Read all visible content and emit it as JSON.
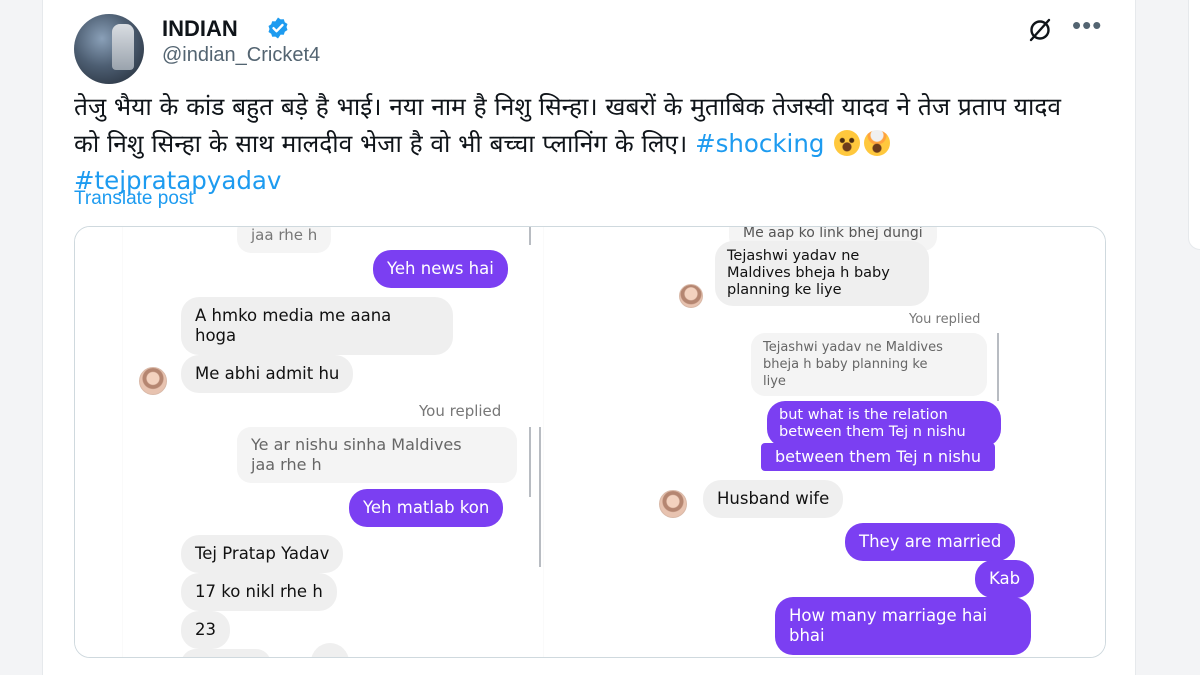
{
  "post": {
    "display_name": "INDIAN",
    "handle": "@indian_Cricket4",
    "text_main": "तेजु भैया के कांड बहुत बड़े है भाई। नया नाम है निशु सिन्हा। खबरों के मुताबिक तेजस्वी यादव ने तेज प्रताप यादव को निशु सिन्हा के साथ मालदीव भेजा है वो भी बच्चा प्लानिंग के लिए।",
    "hashtag_1": "#shocking",
    "hashtag_2": "#tejpratapyadav",
    "translate_label": "Translate post",
    "icons": [
      "verified-badge-icon",
      "grok-icon",
      "more-icon",
      "emoji-hushed-face",
      "emoji-exploding-head"
    ],
    "colors": {
      "link": "#1d9bf0",
      "verified": "#1d9bf0",
      "sent_bubble": "#7b3ff2"
    }
  },
  "chat_left": {
    "top_fragment": "jaa rhe h",
    "msg_1": "Yeh news hai",
    "msg_2_line1": "A hmko media me aana",
    "msg_2_line2": "hoga",
    "msg_3": "Me abhi admit hu",
    "you_replied": "You replied",
    "quote_line1": "Ye ar nishu sinha Maldives",
    "quote_line2": "jaa rhe h",
    "msg_4": "Yeh matlab kon",
    "msg_5": "Tej Pratap Yadav",
    "msg_6": "17 ko nikl rhe h",
    "msg_7": "23"
  },
  "chat_right": {
    "top_fragment": "Me aap ko link bhej dungi",
    "msg_1_line1": "Tejashwi yadav ne",
    "msg_1_line2": "Maldives bheja h baby",
    "msg_1_line3": "planning ke liye",
    "you_replied": "You replied",
    "quote_line1": "Tejashwi yadav ne Maldives",
    "quote_line2": "bheja h baby planning ke",
    "quote_line3": "liye",
    "msg_2_line1": "but what is the relation",
    "msg_2_line2": "between them Tej n nishu",
    "msg_2_dup": "between them Tej n nishu",
    "msg_3": "Husband wife",
    "msg_4": "They are married",
    "msg_5": "Kab",
    "msg_6_line1": "How many marriage hai",
    "msg_6_line2": "bhai"
  }
}
